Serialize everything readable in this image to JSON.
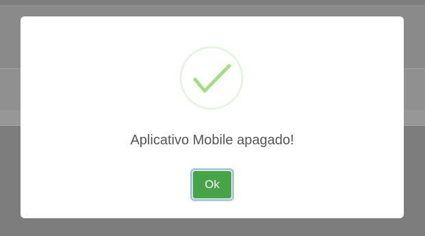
{
  "dialog": {
    "icon": "success-check-icon",
    "message": "Aplicativo Mobile apagado!",
    "ok_label": "Ok"
  },
  "colors": {
    "overlay": "#8a8a8a",
    "success_ring": "#e6f4e1",
    "success_check": "#a5dc86",
    "ok_button": "#45a348",
    "ok_focus_ring": "#a8c7d9",
    "message_text": "#545454"
  }
}
